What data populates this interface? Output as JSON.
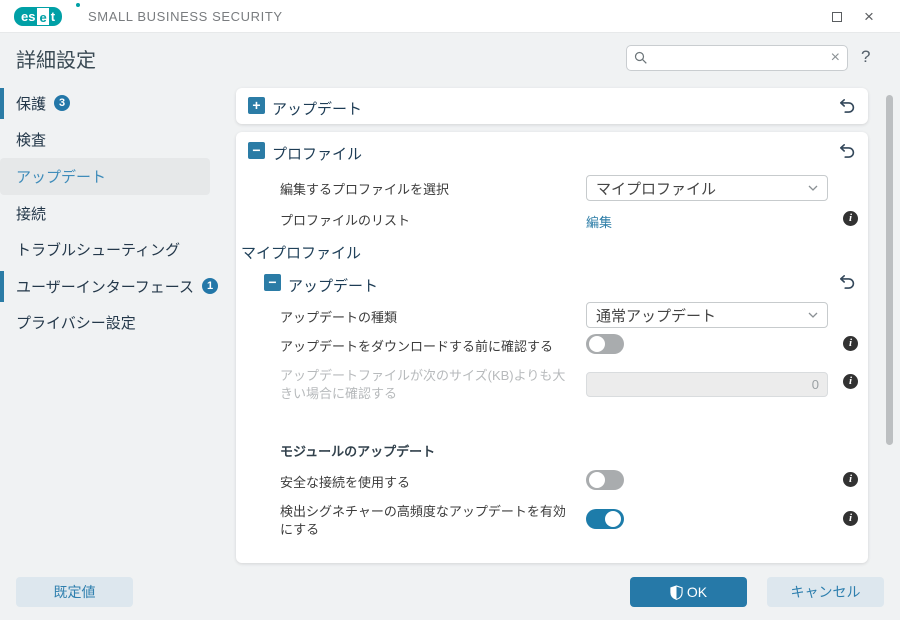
{
  "titlebar": {
    "logo_parts": {
      "p1": "es",
      "p2": "e",
      "p3": "t"
    },
    "brand": "SMALL BUSINESS SECURITY",
    "maximize": "",
    "close": "×"
  },
  "header": {
    "title": "詳細設定",
    "search_value": "",
    "search_placeholder": "",
    "clear": "×",
    "help": "?"
  },
  "sidebar": {
    "items": [
      {
        "label": "保護",
        "badge": "3",
        "selected": false,
        "marked": true
      },
      {
        "label": "検査",
        "badge": "",
        "selected": false,
        "marked": false
      },
      {
        "label": "アップデート",
        "badge": "",
        "selected": true,
        "marked": false
      },
      {
        "label": "接続",
        "badge": "",
        "selected": false,
        "marked": false
      },
      {
        "label": "トラブルシューティング",
        "badge": "",
        "selected": false,
        "marked": false
      },
      {
        "label": "ユーザーインターフェース",
        "badge": "1",
        "selected": false,
        "marked": true
      },
      {
        "label": "プライバシー設定",
        "badge": "",
        "selected": false,
        "marked": false
      }
    ]
  },
  "main": {
    "update_collapsed": {
      "title": "アップデート"
    },
    "profile": {
      "title": "プロファイル",
      "select_profile_label": "編集するプロファイルを選択",
      "select_profile_value": "マイプロファイル",
      "profile_list_label": "プロファイルのリスト",
      "profile_list_action": "編集",
      "subsection_title": "マイプロファイル",
      "update_group": {
        "title": "アップデート",
        "type_label": "アップデートの種類",
        "type_value": "通常アップデート",
        "ask_label": "アップデートをダウンロードする前に確認する",
        "size_label": "アップデートファイルが次のサイズ(KB)よりも大きい場合に確認する",
        "size_value": "0",
        "module_header": "モジュールのアップデート",
        "secure_label": "安全な接続を使用する",
        "frequent_label": "検出シグネチャーの高頻度なアップデートを有効にする"
      }
    }
  },
  "toggles": {
    "ask_before_download": false,
    "use_secure_connection": false,
    "frequent_signature_updates": true
  },
  "footer": {
    "default_label": "既定値",
    "ok_label": "OK",
    "cancel_label": "キャンセル"
  },
  "colors": {
    "accent_blue": "#2b7ca6",
    "brand_teal": "#00a0a6",
    "toggle_on": "#1d7caa",
    "background": "#f0f2f3"
  }
}
